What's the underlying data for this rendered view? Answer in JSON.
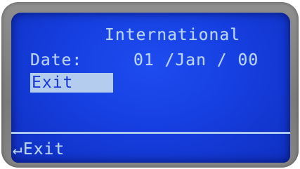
{
  "screen": {
    "title": "International",
    "date_label": "Date:",
    "date_value": "01 /Jan / 00",
    "menu_item": "Exit",
    "footer_action": "↵Exit"
  },
  "colors": {
    "lcd_background": "#163fe0",
    "lcd_text": "#b9d4f2",
    "bezel": "#808080",
    "highlight": "#b4cdee"
  }
}
